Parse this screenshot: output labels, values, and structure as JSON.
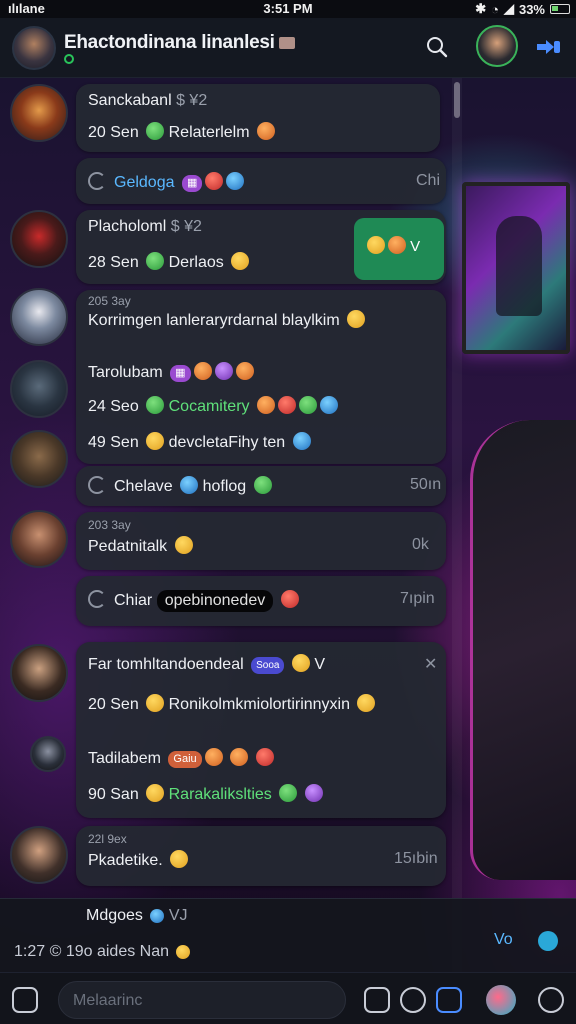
{
  "status_bar": {
    "carrier": "ılılane",
    "time": "3:51 PM",
    "battery": "33%"
  },
  "header": {
    "title": "Ehactondinana linanlesi"
  },
  "messages": [
    {
      "name": "Sanckabanl",
      "suffix": "$ ¥2",
      "line": "20 Sen",
      "text": "Relaterlelm"
    },
    {
      "reply_text": "Geldoga",
      "meta": "Chi"
    },
    {
      "name": "Placholoml",
      "suffix": "$ ¥2",
      "line": "28 Sen",
      "text": "Derlaos"
    },
    {
      "small": "205 3ay",
      "text": "Korrimgen lanleraryrdarnal blaylkim"
    },
    {
      "name": "Tarolubam",
      "line": "24 Seo",
      "text": "Cocamitery"
    },
    {
      "line": "49 Sen",
      "text": "devcletaFihy ten"
    },
    {
      "reply_text": "Chelave",
      "reply_text2": "hoflog",
      "meta": "50ın"
    },
    {
      "small": "203 3ay",
      "text": "Pedatnitalk",
      "meta": "0k"
    },
    {
      "reply_text": "Chiar",
      "chip": "opebinonedev",
      "meta": "7ıpin"
    },
    {
      "name": "Far tomhltandoendeal",
      "tag": "Sooa",
      "suffix": "V",
      "line": "20 Sen",
      "text": "Ronikolmkmiolortirinnyxin"
    },
    {
      "name": "Tadilabem",
      "tag": "Gaiu",
      "line": "90 San",
      "text": "Rarakalikslties"
    },
    {
      "small": "22l 9ex",
      "text": "Pkadetike.",
      "meta": "15ıbin"
    }
  ],
  "green_chip": "V",
  "preview": {
    "name": "Mdgoes",
    "suffix": "VJ",
    "time": "1:27 ©",
    "text": "19o aides Nan",
    "right": "Vo"
  },
  "composer": {
    "placeholder": "Melaarinc"
  },
  "colors": {
    "accent_blue": "#5ab8ff",
    "accent_green": "#29c35a",
    "bubble": "#242832"
  }
}
